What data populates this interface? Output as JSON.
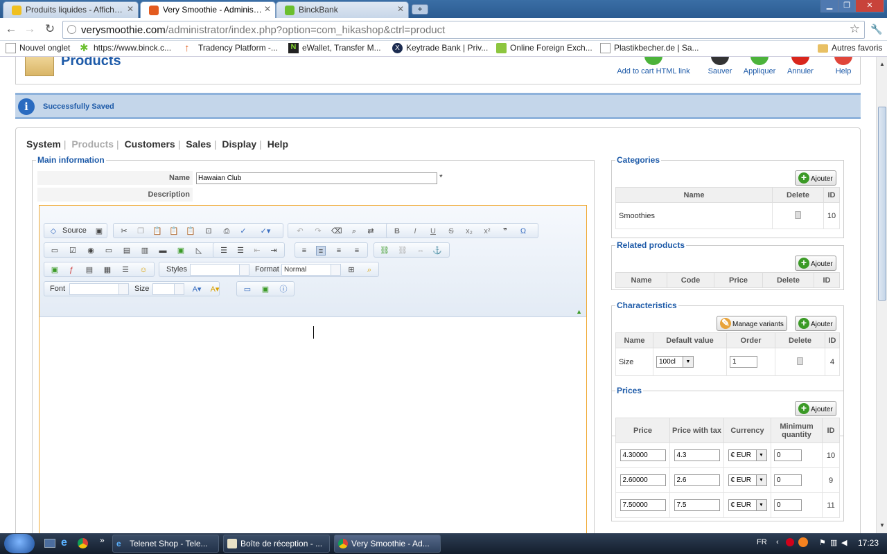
{
  "browser": {
    "tabs": [
      {
        "label": "Produits liquides - Affich…",
        "active": false
      },
      {
        "label": "Very Smoothie - Adminis…",
        "active": true
      },
      {
        "label": "BinckBank",
        "active": false
      }
    ],
    "url_domain": "verysmoothie.com",
    "url_path": "/administrator/index.php?option=com_hikashop&ctrl=product",
    "bookmarks": [
      "Nouvel onglet",
      "https://www.binck.c...",
      "Tradency Platform -...",
      "eWallet, Transfer M...",
      "Keytrade Bank | Priv...",
      "Online Foreign Exch...",
      "Plastikbecher.de | Sa..."
    ],
    "other_bookmarks": "Autres favoris"
  },
  "header": {
    "title": "Products",
    "toolbar": [
      "Add to cart HTML link",
      "Sauver",
      "Appliquer",
      "Annuler",
      "Help"
    ]
  },
  "message": "Successfully Saved",
  "menu": [
    "System",
    "Products",
    "Customers",
    "Sales",
    "Display",
    "Help"
  ],
  "main_info": {
    "legend": "Main information",
    "name_label": "Name",
    "name_value": "Hawaian Club",
    "required_mark": "*",
    "description_label": "Description"
  },
  "editor": {
    "source_label": "Source",
    "styles_label": "Styles",
    "format_label": "Format",
    "format_value": "Normal",
    "font_label": "Font",
    "size_label": "Size"
  },
  "categories": {
    "legend": "Categories",
    "add_label": "Ajouter",
    "columns": [
      "Name",
      "Delete",
      "ID"
    ],
    "rows": [
      {
        "name": "Smoothies",
        "id": "10"
      }
    ]
  },
  "related": {
    "legend": "Related products",
    "add_label": "Ajouter",
    "columns": [
      "Name",
      "Code",
      "Price",
      "Delete",
      "ID"
    ]
  },
  "characteristics": {
    "legend": "Characteristics",
    "variants_label": "Manage variants",
    "add_label": "Ajouter",
    "columns": [
      "Name",
      "Default value",
      "Order",
      "Delete",
      "ID"
    ],
    "rows": [
      {
        "name": "Size",
        "default": "100cl",
        "order": "1",
        "id": "4"
      }
    ]
  },
  "prices": {
    "legend": "Prices",
    "add_label": "Ajouter",
    "columns": [
      "Price",
      "Price with tax",
      "Currency",
      "Minimum quantity",
      "ID"
    ],
    "rows": [
      {
        "price": "4.30000",
        "tax": "4.3",
        "currency": "€ EUR",
        "min": "0",
        "id": "10"
      },
      {
        "price": "2.60000",
        "tax": "2.6",
        "currency": "€ EUR",
        "min": "0",
        "id": "9"
      },
      {
        "price": "7.50000",
        "tax": "7.5",
        "currency": "€ EUR",
        "min": "0",
        "id": "11"
      }
    ]
  },
  "taskbar": {
    "items": [
      "Telenet Shop - Tele...",
      "Boîte de réception - ...",
      "Very Smoothie - Ad..."
    ],
    "lang": "FR",
    "time": "17:23"
  }
}
